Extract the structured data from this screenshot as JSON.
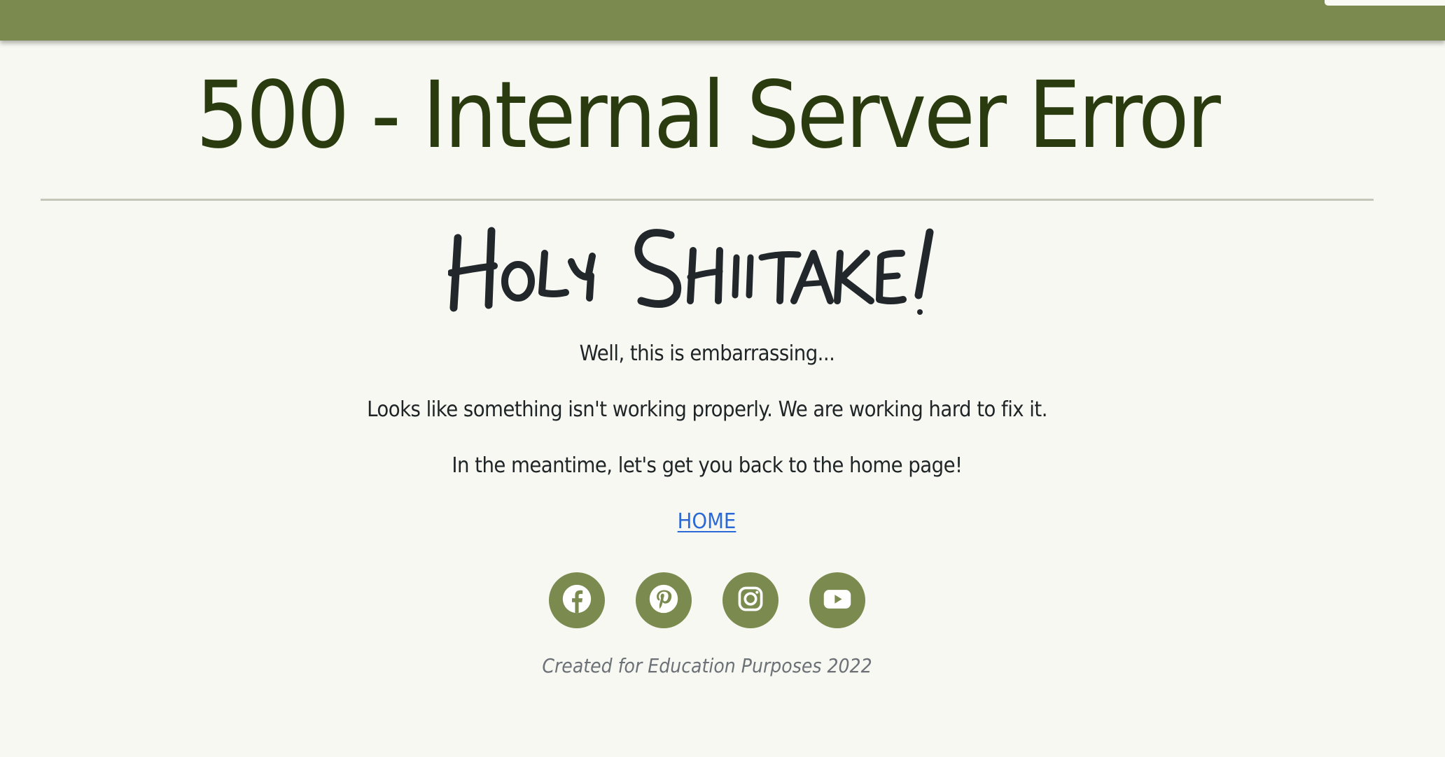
{
  "header": {
    "bar_color": "#7b8b4f"
  },
  "error": {
    "title": "500 - Internal Server Error",
    "headline": "Holy Shiitake!"
  },
  "message": {
    "line1": "Well, this is embarrassing...",
    "line2": "Looks like something isn't working properly. We are working hard to fix it.",
    "line3": "In the meantime, let's get you back to the home page!"
  },
  "home_link": {
    "label": "HOME"
  },
  "social": {
    "items": [
      {
        "name": "facebook",
        "icon": "facebook-icon"
      },
      {
        "name": "pinterest",
        "icon": "pinterest-icon"
      },
      {
        "name": "instagram",
        "icon": "instagram-icon"
      },
      {
        "name": "youtube",
        "icon": "youtube-icon"
      }
    ],
    "color": "#7b8b4f"
  },
  "footer": {
    "text": "Created for Education Purposes 2022"
  },
  "colors": {
    "background": "#f7f8f1",
    "title": "#2a3b0f",
    "text": "#1f2426",
    "link": "#2b69d6",
    "footer": "#6b7176"
  }
}
